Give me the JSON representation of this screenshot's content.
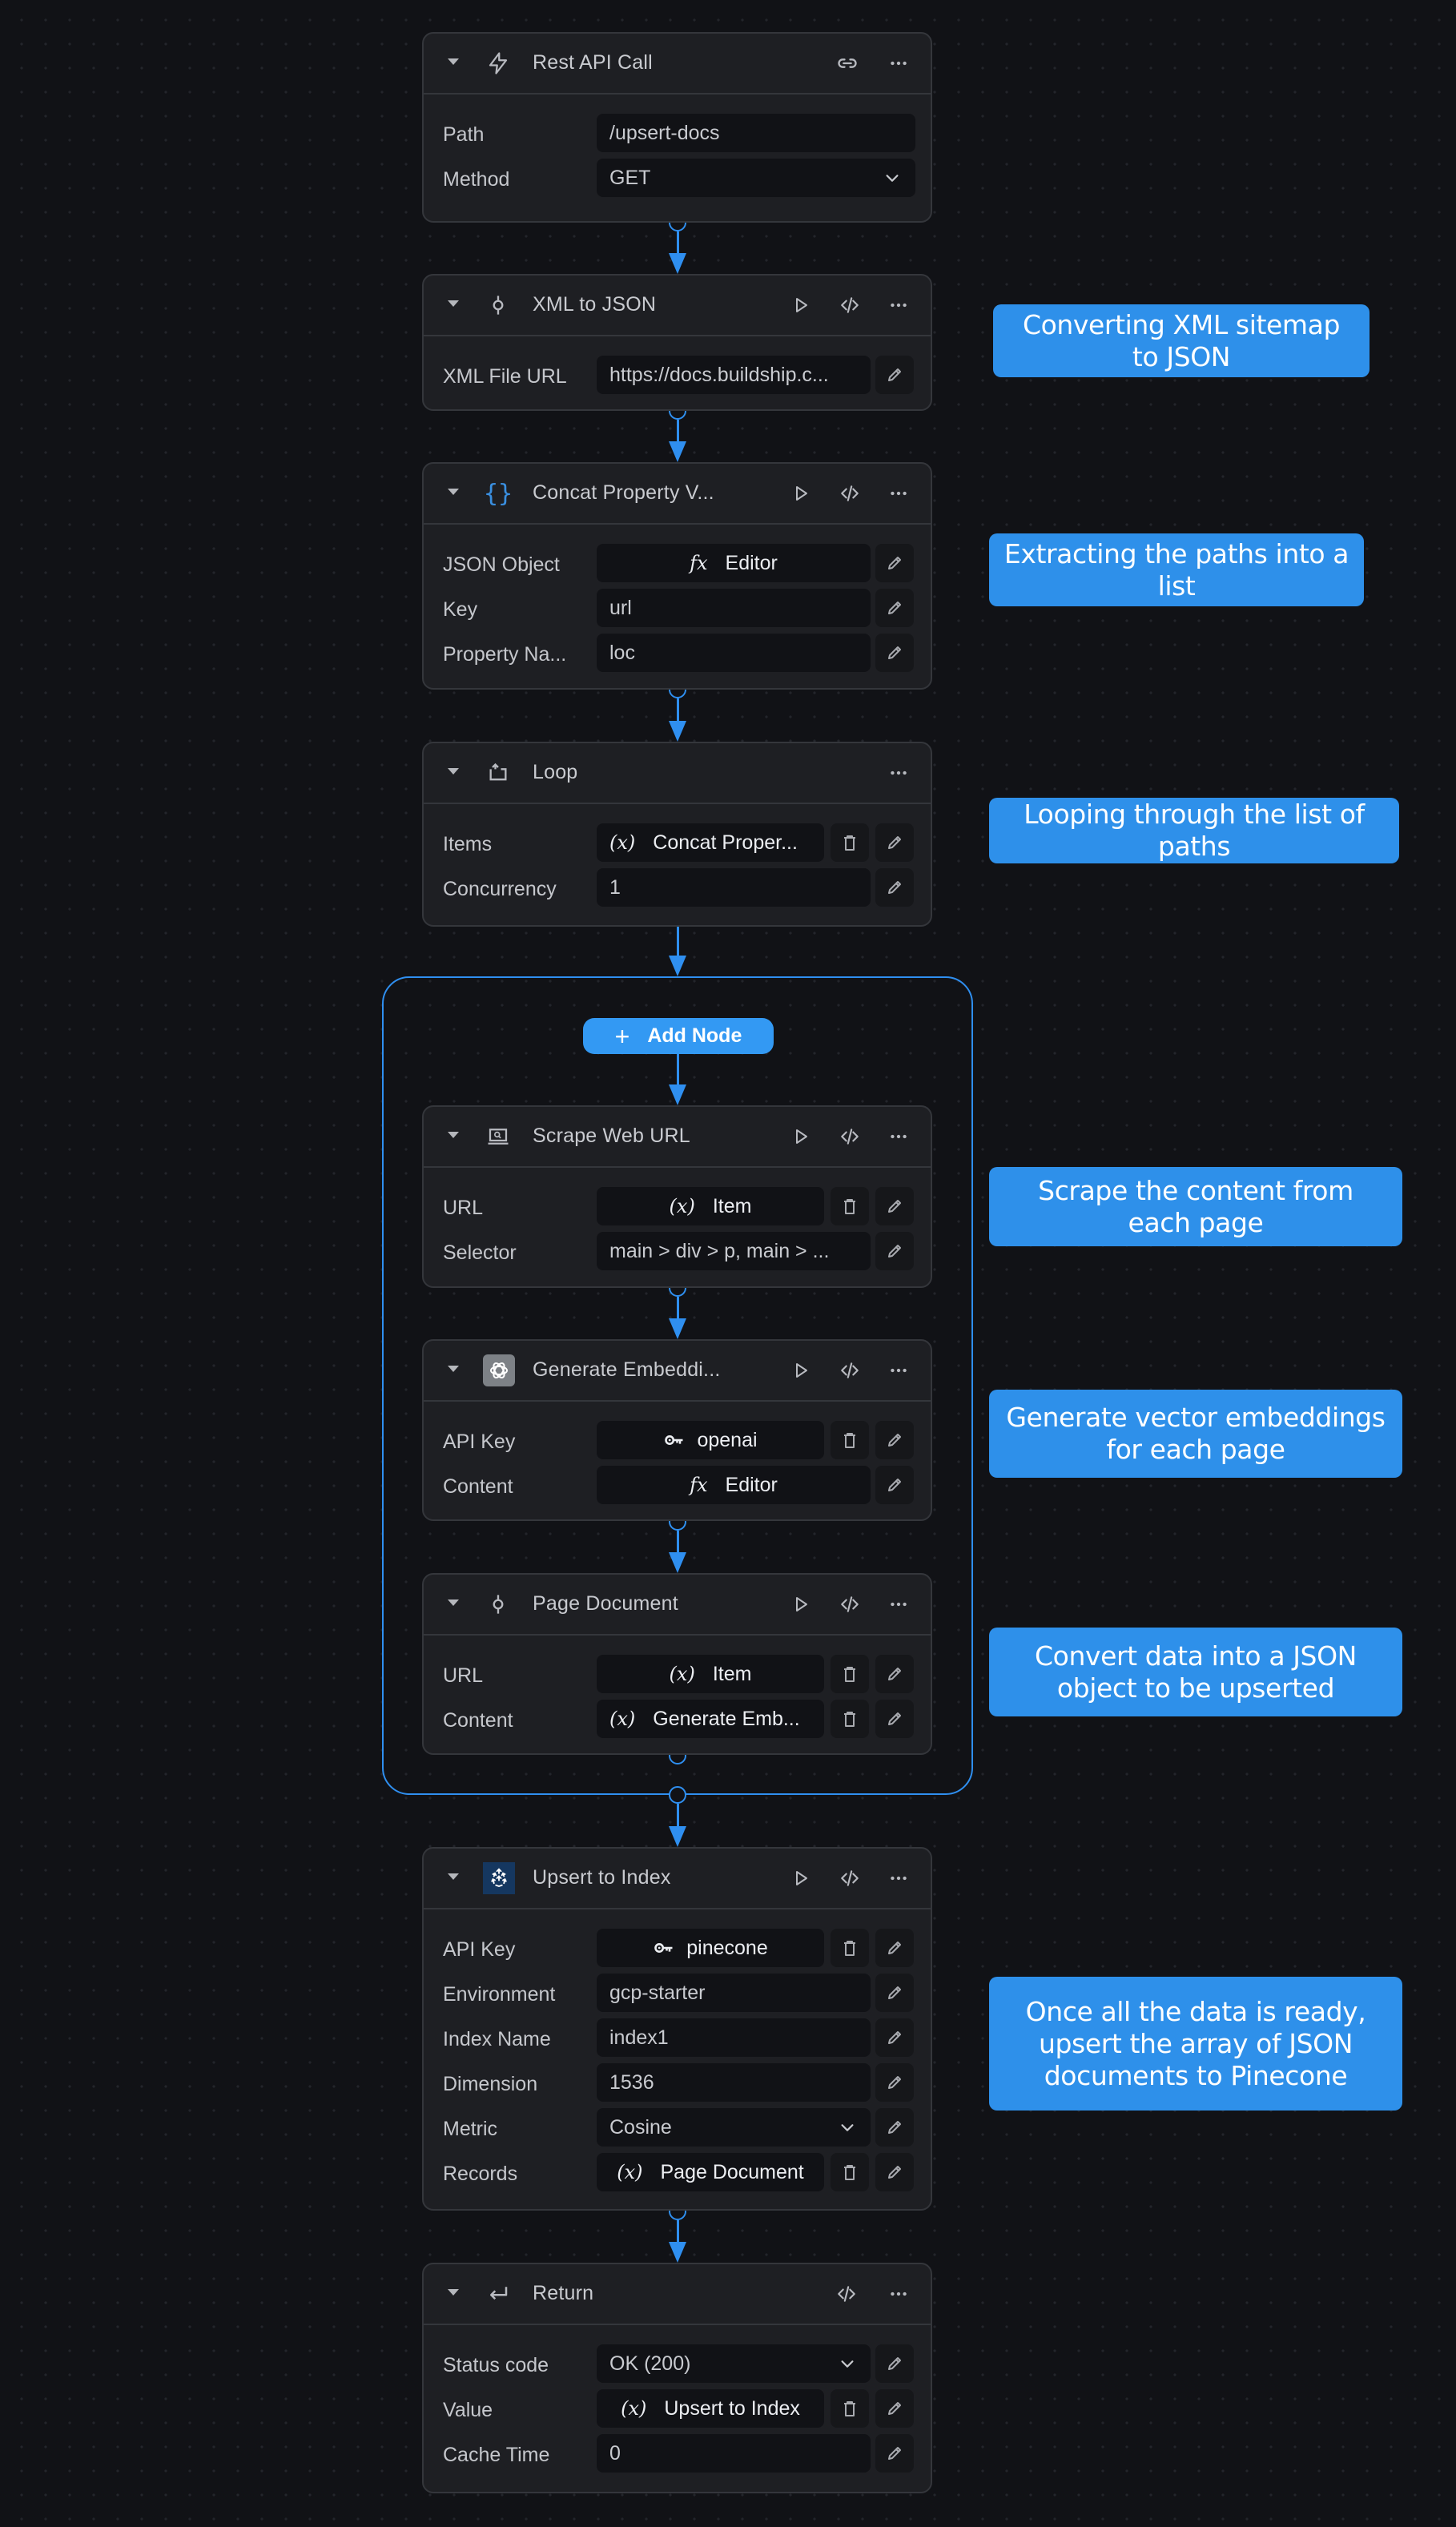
{
  "colors": {
    "accent": "#2f8ff0",
    "note_bg": "#2e90ea",
    "canvas_bg": "#111216",
    "node_bg": "#1e1f23"
  },
  "nodes": {
    "rest_api": {
      "title": "Rest API Call",
      "icon": "lightning-icon",
      "fields": {
        "path_label": "Path",
        "path_value": "/upsert-docs",
        "method_label": "Method",
        "method_value": "GET"
      }
    },
    "xml_to_json": {
      "title": "XML to JSON",
      "icon": "commit-node-icon",
      "fields": {
        "url_label": "XML File URL",
        "url_value": "https://docs.buildship.c..."
      }
    },
    "concat": {
      "title": "Concat Property V...",
      "icon": "braces-icon",
      "fields": {
        "json_label": "JSON Object",
        "json_value": "Editor",
        "key_label": "Key",
        "key_value": "url",
        "prop_label": "Property Na...",
        "prop_value": "loc"
      }
    },
    "loop": {
      "title": "Loop",
      "icon": "loop-icon",
      "fields": {
        "items_label": "Items",
        "items_value": "Concat Proper...",
        "concurrency_label": "Concurrency",
        "concurrency_value": "1"
      }
    },
    "add_node": {
      "label": "Add Node"
    },
    "scrape": {
      "title": "Scrape Web URL",
      "icon": "laptop-search-icon",
      "fields": {
        "url_label": "URL",
        "url_value": "Item",
        "selector_label": "Selector",
        "selector_value": "main > div > p, main > ..."
      }
    },
    "embed": {
      "title": "Generate Embeddi...",
      "icon": "openai-icon",
      "fields": {
        "apikey_label": "API Key",
        "apikey_value": "openai",
        "content_label": "Content",
        "content_value": "Editor"
      }
    },
    "page_doc": {
      "title": "Page Document",
      "icon": "commit-node-icon",
      "fields": {
        "url_label": "URL",
        "url_value": "Item",
        "content_label": "Content",
        "content_value": "Generate Emb..."
      }
    },
    "upsert": {
      "title": "Upsert to Index",
      "icon": "pinecone-icon",
      "fields": {
        "apikey_label": "API Key",
        "apikey_value": "pinecone",
        "env_label": "Environment",
        "env_value": "gcp-starter",
        "index_label": "Index Name",
        "index_value": "index1",
        "dim_label": "Dimension",
        "dim_value": "1536",
        "metric_label": "Metric",
        "metric_value": "Cosine",
        "records_label": "Records",
        "records_value": "Page Document"
      }
    },
    "return": {
      "title": "Return",
      "icon": "return-icon",
      "fields": {
        "status_label": "Status code",
        "status_value": "OK (200)",
        "value_label": "Value",
        "value_value": "Upsert to Index",
        "cache_label": "Cache Time",
        "cache_value": "0"
      }
    }
  },
  "symbols": {
    "variable": "(x)",
    "function": "fx"
  },
  "notes": [
    "Converting XML sitemap to JSON",
    "Extracting the paths into a list",
    "Looping through the list of paths",
    "Scrape the content from each page",
    "Generate vector embeddings for each page",
    "Convert data into a JSON object to be upserted",
    "Once all the data is ready, upsert the array of JSON documents to Pinecone"
  ]
}
